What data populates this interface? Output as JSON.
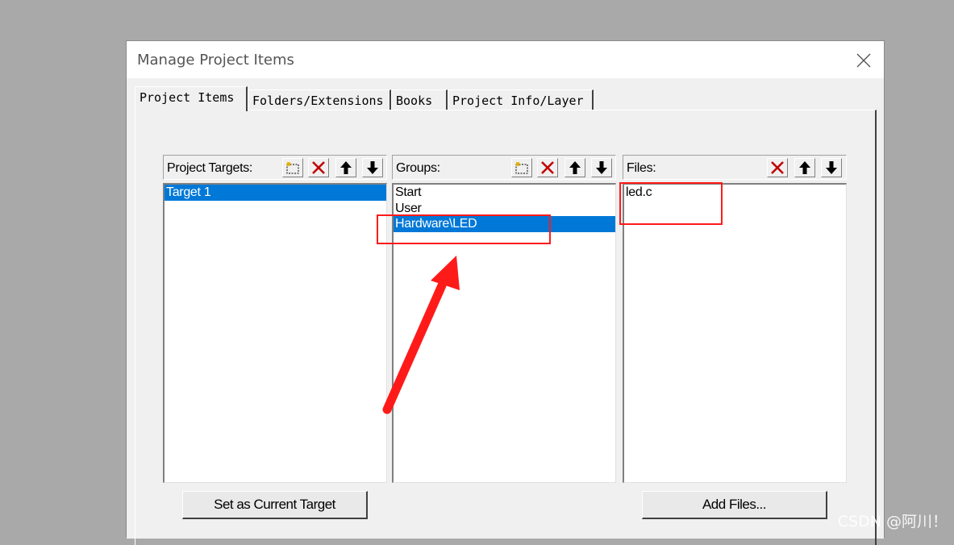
{
  "dialog": {
    "title": "Manage Project Items"
  },
  "tabs": [
    {
      "label": "Project Items",
      "active": true
    },
    {
      "label": "Folders/Extensions",
      "active": false
    },
    {
      "label": "Books",
      "active": false
    },
    {
      "label": "Project Info/Layer",
      "active": false
    }
  ],
  "targets": {
    "label": "Project Targets:",
    "items": [
      "Target 1"
    ],
    "selected": "Target 1"
  },
  "groups": {
    "label": "Groups:",
    "items": [
      "Start",
      "User",
      "Hardware\\LED"
    ],
    "selected": "Hardware\\LED"
  },
  "files": {
    "label": "Files:",
    "items": [
      "led.c"
    ]
  },
  "buttons": {
    "set_current_target": "Set as Current Target",
    "add_files": "Add Files..."
  },
  "toolbar_icons": [
    "new-icon",
    "delete-icon",
    "move-up-icon",
    "move-down-icon"
  ],
  "colors": {
    "selection": "#0078d7",
    "annotation": "#ff1a1a",
    "delete_icon": "#c00000"
  },
  "watermark": "CSDN @阿川！"
}
